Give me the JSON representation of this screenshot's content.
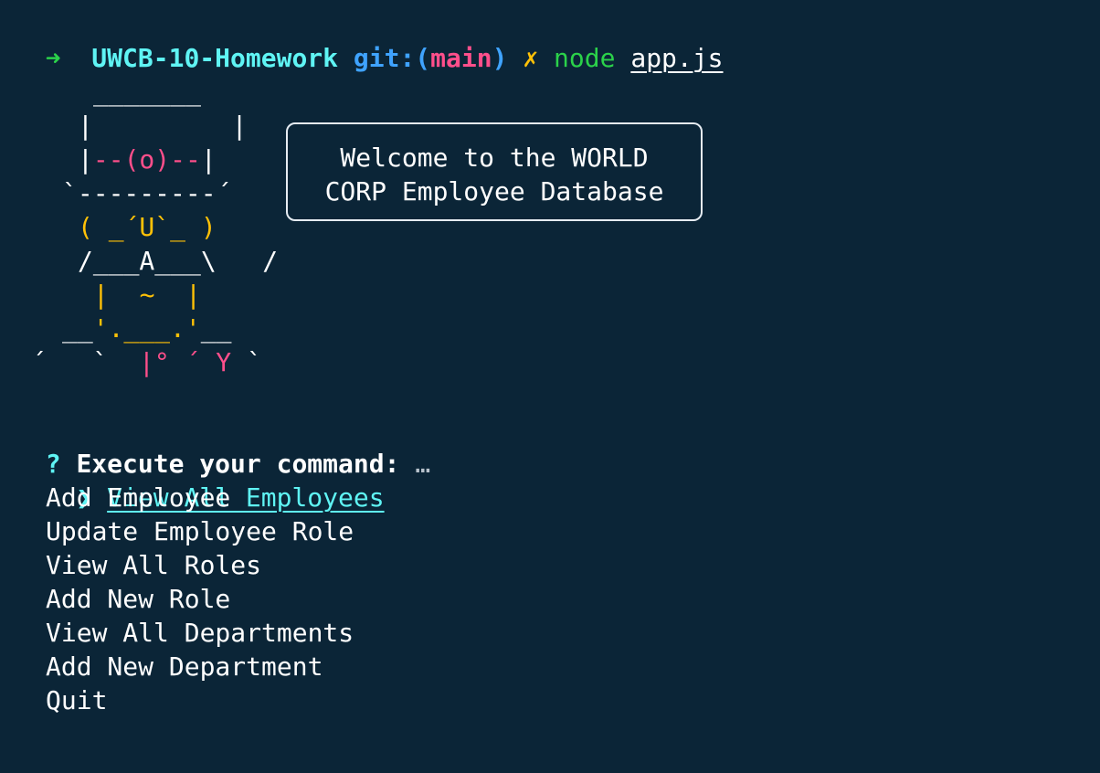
{
  "prompt_line": {
    "arrow": "➜",
    "dir": "UWCB-10-Homework",
    "git_prefix": "git:(",
    "branch": "main",
    "git_suffix": ")",
    "dirty_mark": "✗",
    "cmd": "node",
    "arg": "app.js"
  },
  "ascii": {
    "l1": "_____",
    "l1_left": "_",
    "l1_right": "_",
    "l2": "|         |",
    "l3_bar_l": "|",
    "l3_mid": "--(o)--",
    "l3_bar_r": "|",
    "l4": "`---------´",
    "l5": "( _´U`_ )",
    "l6a": "/___A___\\",
    "l6b": "/",
    "l7": "|  ~  |",
    "l8a": "__",
    "l8b": "'.___.'",
    "l8c": "__",
    "l9a": "´   `",
    "l9b": "|° ´ Y",
    "l9c": "`"
  },
  "welcome": {
    "line1": "Welcome to the WORLD",
    "line2": "CORP Employee Database"
  },
  "question": {
    "mark": "?",
    "text": "Execute your command:",
    "ellipsis": "…"
  },
  "menu": {
    "pointer": "❯",
    "items": [
      "View All Employees",
      "Add Employee",
      "Update Employee Role",
      "View All Roles",
      "Add New Role",
      "View All Departments",
      "Add New Department",
      "Quit"
    ]
  }
}
